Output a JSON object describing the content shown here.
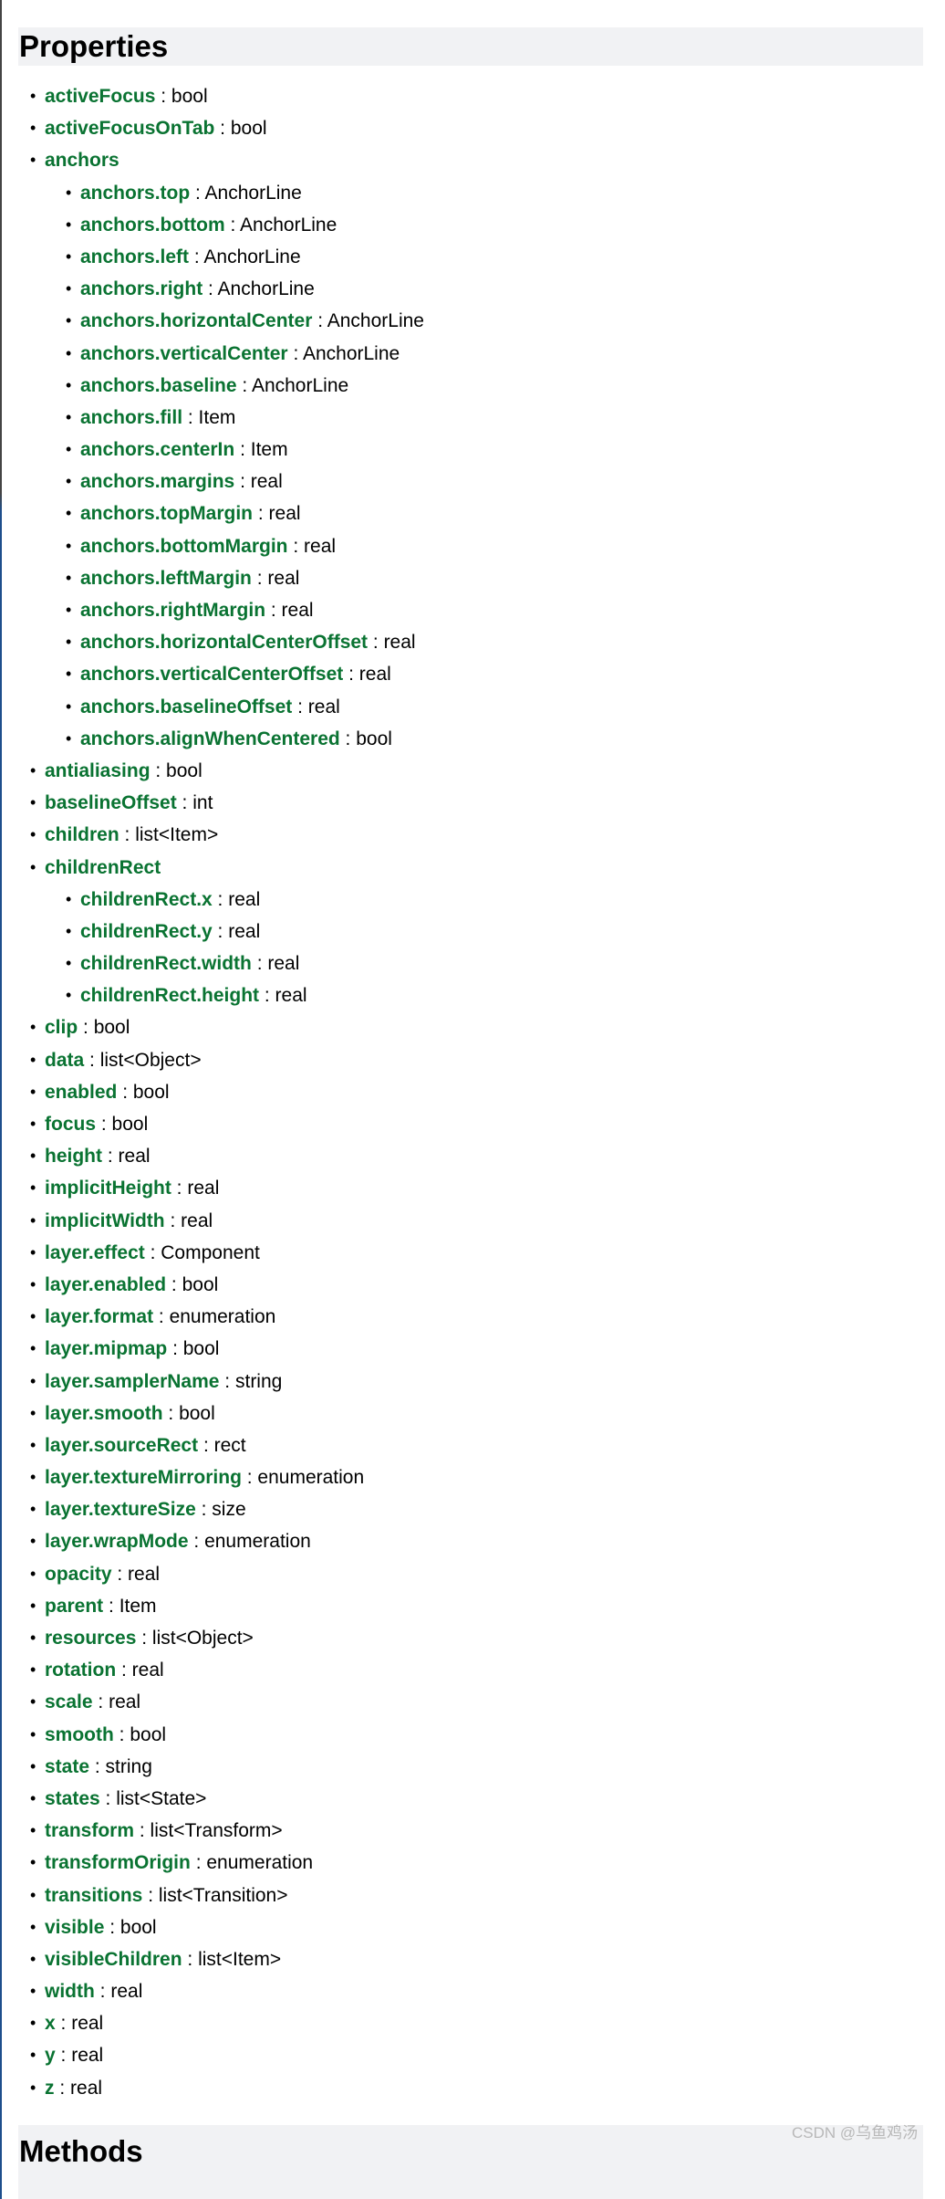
{
  "headings": {
    "properties": "Properties",
    "methods": "Methods"
  },
  "properties": [
    {
      "name": "activeFocus",
      "type": "bool",
      "level": 0
    },
    {
      "name": "activeFocusOnTab",
      "type": "bool",
      "level": 0
    },
    {
      "name": "anchors",
      "type": "",
      "level": 0
    },
    {
      "name": "anchors.top",
      "type": "AnchorLine",
      "level": 1
    },
    {
      "name": "anchors.bottom",
      "type": "AnchorLine",
      "level": 1
    },
    {
      "name": "anchors.left",
      "type": "AnchorLine",
      "level": 1
    },
    {
      "name": "anchors.right",
      "type": "AnchorLine",
      "level": 1
    },
    {
      "name": "anchors.horizontalCenter",
      "type": "AnchorLine",
      "level": 1
    },
    {
      "name": "anchors.verticalCenter",
      "type": "AnchorLine",
      "level": 1
    },
    {
      "name": "anchors.baseline",
      "type": "AnchorLine",
      "level": 1
    },
    {
      "name": "anchors.fill",
      "type": "Item",
      "level": 1
    },
    {
      "name": "anchors.centerIn",
      "type": "Item",
      "level": 1
    },
    {
      "name": "anchors.margins",
      "type": "real",
      "level": 1
    },
    {
      "name": "anchors.topMargin",
      "type": "real",
      "level": 1
    },
    {
      "name": "anchors.bottomMargin",
      "type": "real",
      "level": 1
    },
    {
      "name": "anchors.leftMargin",
      "type": "real",
      "level": 1
    },
    {
      "name": "anchors.rightMargin",
      "type": "real",
      "level": 1
    },
    {
      "name": "anchors.horizontalCenterOffset",
      "type": "real",
      "level": 1
    },
    {
      "name": "anchors.verticalCenterOffset",
      "type": "real",
      "level": 1
    },
    {
      "name": "anchors.baselineOffset",
      "type": "real",
      "level": 1
    },
    {
      "name": "anchors.alignWhenCentered",
      "type": "bool",
      "level": 1
    },
    {
      "name": "antialiasing",
      "type": "bool",
      "level": 0
    },
    {
      "name": "baselineOffset",
      "type": "int",
      "level": 0
    },
    {
      "name": "children",
      "type": "list<Item>",
      "level": 0
    },
    {
      "name": "childrenRect",
      "type": "",
      "level": 0
    },
    {
      "name": "childrenRect.x",
      "type": "real",
      "level": 1
    },
    {
      "name": "childrenRect.y",
      "type": "real",
      "level": 1
    },
    {
      "name": "childrenRect.width",
      "type": "real",
      "level": 1
    },
    {
      "name": "childrenRect.height",
      "type": "real",
      "level": 1
    },
    {
      "name": "clip",
      "type": "bool",
      "level": 0
    },
    {
      "name": "data",
      "type": "list<Object>",
      "level": 0
    },
    {
      "name": "enabled",
      "type": "bool",
      "level": 0
    },
    {
      "name": "focus",
      "type": "bool",
      "level": 0
    },
    {
      "name": "height",
      "type": "real",
      "level": 0
    },
    {
      "name": "implicitHeight",
      "type": "real",
      "level": 0
    },
    {
      "name": "implicitWidth",
      "type": "real",
      "level": 0
    },
    {
      "name": "layer.effect",
      "type": "Component",
      "level": 0
    },
    {
      "name": "layer.enabled",
      "type": "bool",
      "level": 0
    },
    {
      "name": "layer.format",
      "type": "enumeration",
      "level": 0
    },
    {
      "name": "layer.mipmap",
      "type": "bool",
      "level": 0
    },
    {
      "name": "layer.samplerName",
      "type": "string",
      "level": 0
    },
    {
      "name": "layer.smooth",
      "type": "bool",
      "level": 0
    },
    {
      "name": "layer.sourceRect",
      "type": "rect",
      "level": 0
    },
    {
      "name": "layer.textureMirroring",
      "type": "enumeration",
      "level": 0
    },
    {
      "name": "layer.textureSize",
      "type": "size",
      "level": 0
    },
    {
      "name": "layer.wrapMode",
      "type": "enumeration",
      "level": 0
    },
    {
      "name": "opacity",
      "type": "real",
      "level": 0
    },
    {
      "name": "parent",
      "type": "Item",
      "level": 0
    },
    {
      "name": "resources",
      "type": "list<Object>",
      "level": 0
    },
    {
      "name": "rotation",
      "type": "real",
      "level": 0
    },
    {
      "name": "scale",
      "type": "real",
      "level": 0
    },
    {
      "name": "smooth",
      "type": "bool",
      "level": 0
    },
    {
      "name": "state",
      "type": "string",
      "level": 0
    },
    {
      "name": "states",
      "type": "list<State>",
      "level": 0
    },
    {
      "name": "transform",
      "type": "list<Transform>",
      "level": 0
    },
    {
      "name": "transformOrigin",
      "type": "enumeration",
      "level": 0
    },
    {
      "name": "transitions",
      "type": "list<Transition>",
      "level": 0
    },
    {
      "name": "visible",
      "type": "bool",
      "level": 0
    },
    {
      "name": "visibleChildren",
      "type": "list<Item>",
      "level": 0
    },
    {
      "name": "width",
      "type": "real",
      "level": 0
    },
    {
      "name": "x",
      "type": "real",
      "level": 0
    },
    {
      "name": "y",
      "type": "real",
      "level": 0
    },
    {
      "name": "z",
      "type": "real",
      "level": 0
    }
  ],
  "watermark": "CSDN @乌鱼鸡汤",
  "colors": {
    "link": "#0a7332",
    "heading_bg": "#f1f2f4"
  }
}
